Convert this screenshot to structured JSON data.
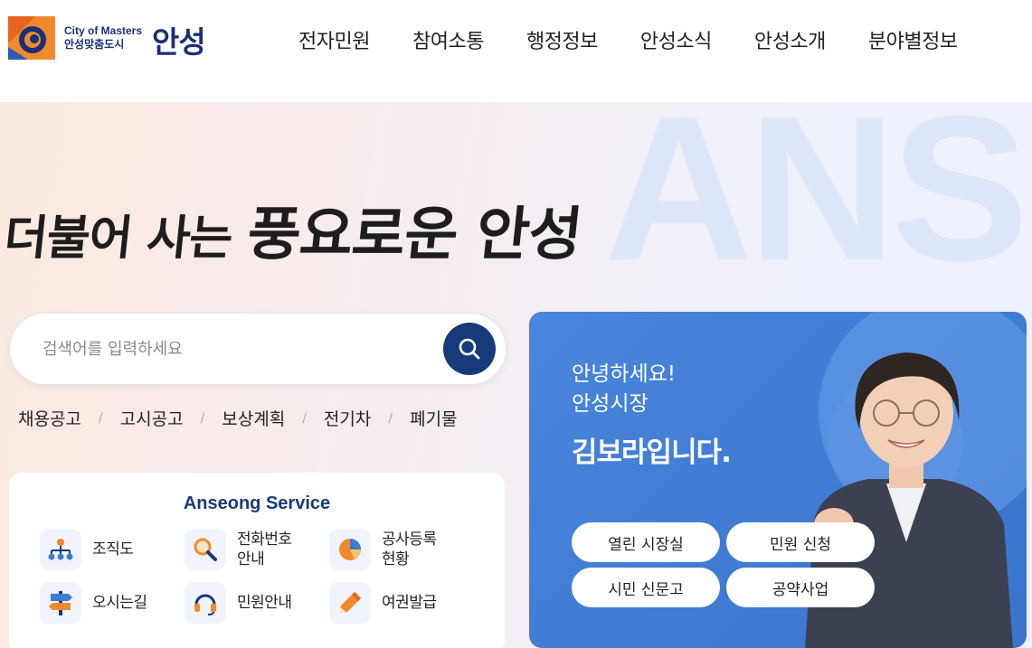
{
  "header": {
    "logo_en": "City of Masters",
    "logo_ko": "안성맞춤도시",
    "logo_big": "안성",
    "nav": [
      "전자민원",
      "참여소통",
      "행정정보",
      "안성소식",
      "안성소개",
      "분야별정보"
    ]
  },
  "hero": {
    "bg_word": "ANS",
    "slogan_part1": "더불어 사는 ",
    "slogan_part2": "풍요로운 ",
    "slogan_part3": "안성"
  },
  "search": {
    "placeholder": "검색어를 입력하세요",
    "button_icon": "search-icon"
  },
  "keywords": [
    "채용공고",
    "고시공고",
    "보상계획",
    "전기차",
    "폐기물"
  ],
  "keyword_separator": "/",
  "service": {
    "title": "Anseong Service",
    "items": [
      {
        "label": "조직도",
        "icon": "org-chart-icon"
      },
      {
        "label": "전화번호\n안내",
        "icon": "magnifier-icon"
      },
      {
        "label": "공사등록\n현황",
        "icon": "pie-chart-icon"
      },
      {
        "label": "오시는길",
        "icon": "signpost-icon"
      },
      {
        "label": "민원안내",
        "icon": "headset-icon"
      },
      {
        "label": "여권발급",
        "icon": "pencil-icon"
      }
    ]
  },
  "mayor": {
    "greeting_line1": "안녕하세요!",
    "greeting_line2": "안성시장",
    "name": "김보라입니다.",
    "buttons": [
      "열린 시장실",
      "민원 신청",
      "시민 신문고",
      "공약사업"
    ]
  },
  "colors": {
    "brand_navy": "#173a7a",
    "card_blue": "#4a86dc",
    "accent_orange": "#f08a2c"
  }
}
